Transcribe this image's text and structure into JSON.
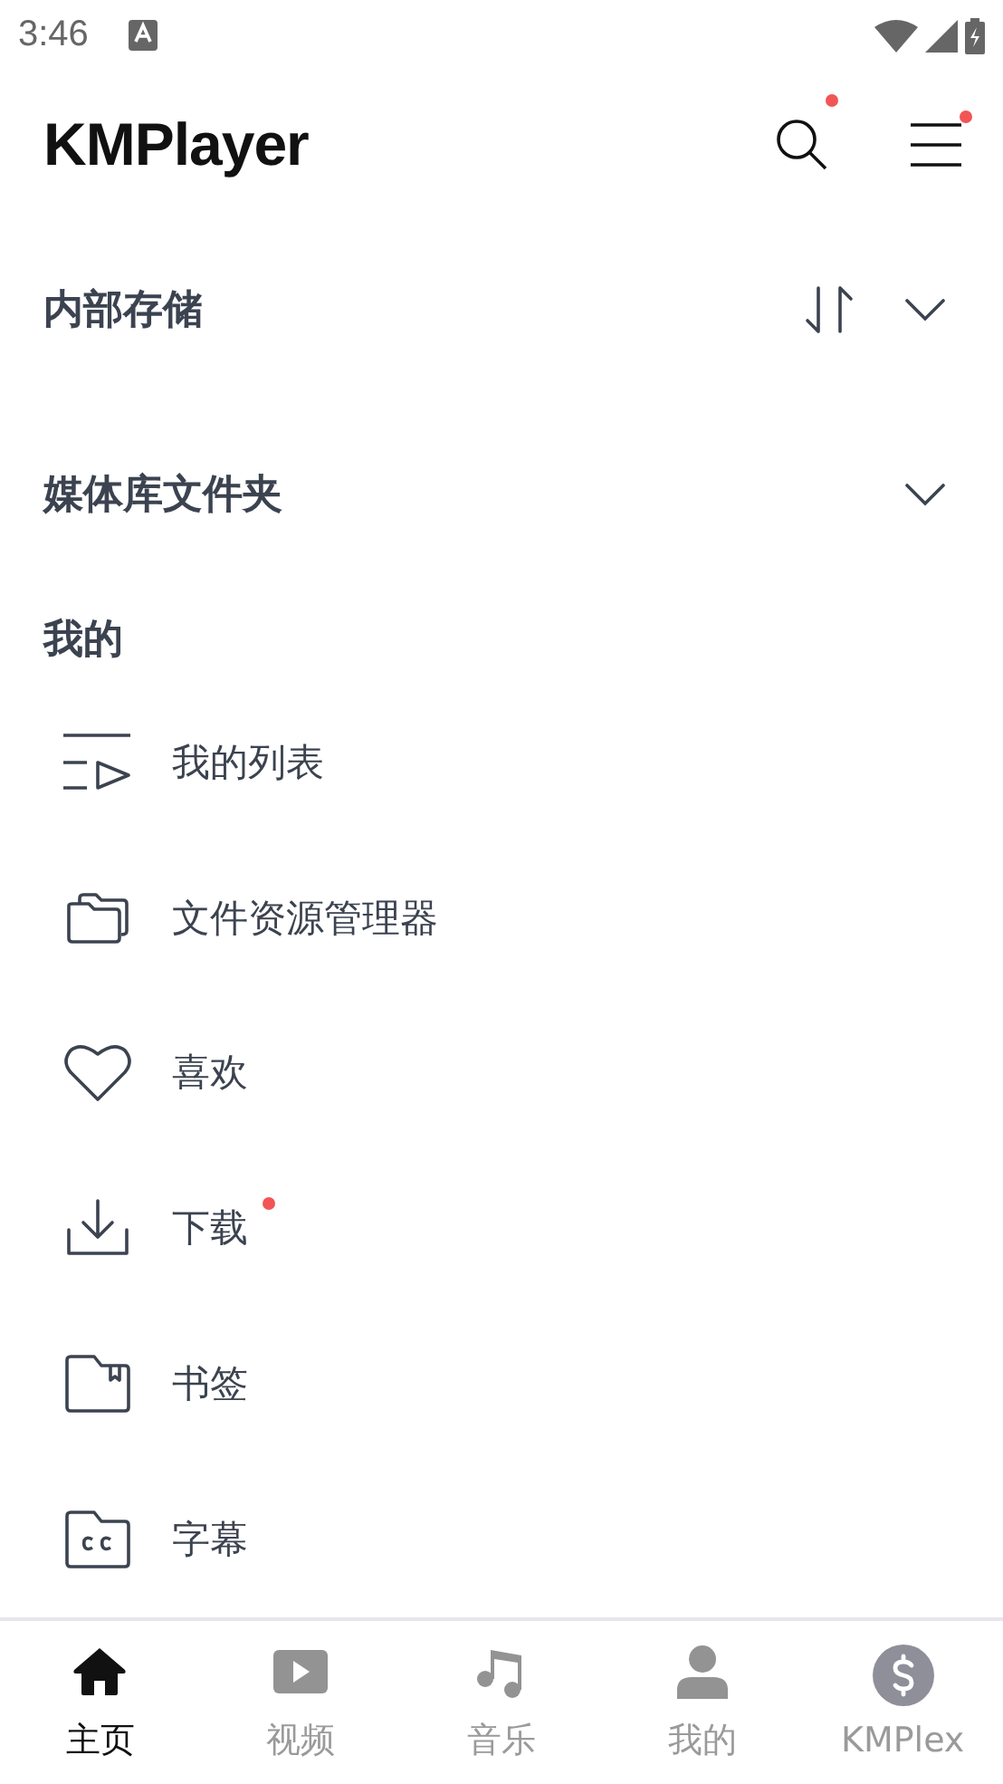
{
  "status_bar": {
    "time": "3:46"
  },
  "header": {
    "logo": "KMPlayer",
    "search_badge": true,
    "menu_badge": true
  },
  "sections": [
    {
      "title": "内部存储",
      "sortable": true,
      "expanded": false
    },
    {
      "title": "媒体库文件夹",
      "sortable": false,
      "expanded": false
    }
  ],
  "my": {
    "title": "我的",
    "items": [
      {
        "kind": "playlist",
        "label": "我的列表",
        "badge": false
      },
      {
        "kind": "explorer",
        "label": "文件资源管理器",
        "badge": false
      },
      {
        "kind": "favorite",
        "label": "喜欢",
        "badge": false
      },
      {
        "kind": "download",
        "label": "下载",
        "badge": true
      },
      {
        "kind": "bookmark",
        "label": "书签",
        "badge": false
      },
      {
        "kind": "subtitle",
        "label": "字幕",
        "badge": false
      }
    ]
  },
  "bottom_nav": [
    {
      "kind": "home",
      "label": "主页",
      "selected": true
    },
    {
      "kind": "video",
      "label": "视频",
      "selected": false
    },
    {
      "kind": "music",
      "label": "音乐",
      "selected": false
    },
    {
      "kind": "profile",
      "label": "我的",
      "selected": false
    },
    {
      "kind": "kmplex",
      "label": "KMPlex",
      "selected": false
    }
  ]
}
